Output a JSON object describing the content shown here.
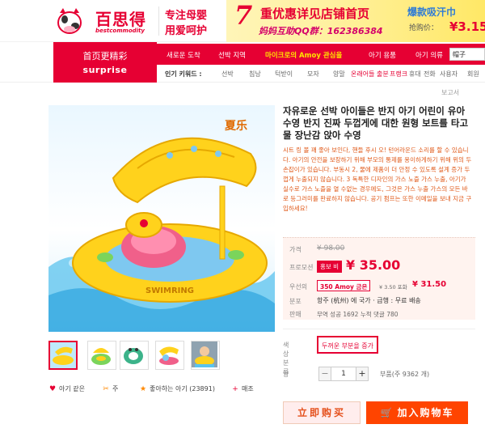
{
  "header": {
    "logo_text": "百思得",
    "logo_sub": "bestcommodity",
    "slogan_line1": "专注母婴",
    "slogan_line2": "用爱呵护",
    "promo_num": "7",
    "promo_line1": "重优惠详见店铺首页",
    "promo_line2": "妈妈互助QQ群：162386384",
    "promo_right1": "爆款吸汗巾",
    "promo_right2": "抢购价：",
    "promo_price": "¥3.15"
  },
  "nav": {
    "feature_line1": "首页更精彩",
    "feature_line2": "surprise",
    "links": [
      "새로운 도착",
      "선박 지역",
      "마이크로의 Amoy 관심을",
      "아기 용품",
      "아기 의류"
    ],
    "search_value": "帽子",
    "keywords_title": "인기 키워드 :",
    "keywords": [
      "선박",
      "침낭",
      "턱받이",
      "모자",
      "양말",
      "온래어들 출분",
      "프랭크",
      "휴대",
      "전화",
      "사용자",
      "회원"
    ]
  },
  "product": {
    "report_label": "보고서",
    "image_brand": "夏乐",
    "image_ring_text": "SWIMRING",
    "title": "자유로운 선박 아이들은 반지 아기 어린이 유아 수영 반지 진짜 두껍게에 대한 원형 보트를 타고 물 장난감 앉아 수영",
    "description": "시트 링 볼 꽤 좋아 보인다, 핸들 후시 오! 턴어라운드 소리를 할 수 있습니다. 아기의 안전을 보장하기 위해 부모의 통제를 용이하게하기 위해 위의 두 손잡이가 있습니다. 부동시 2, 물에 제품이 더 안정 수 있도록 설계 증가 두껍게 누출되지 않습니다. 3 독특한 디자인의 가스 노즐 가스 누출, 아기가 실수로 가스 노즐을 열 수없는 경우에도, 그것은 가스 누출 가스의 모든 바로 등그러미를 완료하지 않습니다. 공기 펌프는 또한 이메일을 보내 지금 구입하세요!",
    "price_label": "가격",
    "original_price": "¥ 98.00",
    "promo_label": "프로모션",
    "promo_tag": "홍보 비",
    "promo_price": "¥ 35.00",
    "special_label": "우선의",
    "amoy_tag": "350 Amoy 금은",
    "amoy_small": "¥ 3.50 포화",
    "amoy_price": "¥ 31.50",
    "ship_label": "분포",
    "ship_text": "항주 (杭州) 에 국가 · 급행 : 무료 배송",
    "sales_label": "판매",
    "sales_text": "무역 성공 1692    누적 댓글 780",
    "color_label": "색상 분류",
    "color_option": "두꺼운 부분을 증가",
    "qty_label": "양",
    "qty_minus": "−",
    "qty_value": "1",
    "qty_plus": "+",
    "stock_text": "부품(주 9362 개)",
    "buy_now": "立即购买",
    "add_cart": "加入购物车",
    "add_cart_icon": "🛒"
  },
  "actions": [
    {
      "icon": "heart-icon",
      "glyph": "♥",
      "color": "#e60033",
      "label": "아기 같은"
    },
    {
      "icon": "share-icon",
      "glyph": "✂",
      "color": "#ff8800",
      "label": "주"
    },
    {
      "icon": "star-icon",
      "glyph": "★",
      "color": "#ff8800",
      "label": "좋아하는 아기 (23891)"
    },
    {
      "icon": "plus-icon",
      "glyph": "+",
      "color": "#e60033",
      "label": "매조"
    }
  ]
}
